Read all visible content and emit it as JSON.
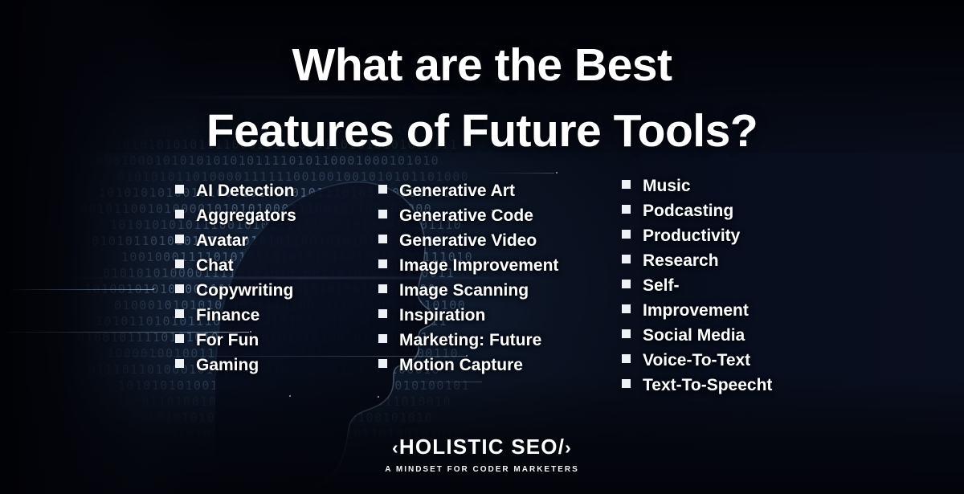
{
  "poster": {
    "title_lines": [
      "What are the Best",
      "Features of Future Tools?"
    ],
    "background": {
      "type": "ai-head-silhouette-binary-code",
      "base_color": "#05060c",
      "navy_color": "#0a0f20",
      "binary_color": "#8fb4d6",
      "binary_rows": [
        "1011010010101010101010010101",
        "0101010101011110001110101011",
        "1000100010101010101011110101",
        "0101010110100001111110010010",
        "1010101010010100010101001011",
        "0010110010100001010101000111",
        "1010101010111001010101101010",
        "0101011010101011010101011001",
        "1001000111101010110101010100",
        "0101010100001111010101010011",
        "1010010101000011110010101010",
        "0100010101010000111101001011",
        "1010110101011101010101010010",
        "0100101111010101000101010101",
        "1000010010011010101011010100",
        "0111011010001010101000101011",
        "1010101010010101010101010010",
        "0010101101001010100010101101",
        "1101010010101010101001010100"
      ]
    },
    "columns": [
      {
        "id": "column-1",
        "items": [
          "AI Detection",
          "Aggregators",
          "Avatar",
          "Chat",
          "Copywriting",
          "Finance",
          "For Fun",
          "Gaming"
        ]
      },
      {
        "id": "column-2",
        "items": [
          "Generative Art",
          "Generative Code",
          "Generative Video",
          "Image Improvement",
          "Image Scanning",
          "Inspiration",
          "Marketing: Future",
          "Motion Capture"
        ]
      },
      {
        "id": "column-3",
        "items": [
          "Music",
          "Podcasting",
          "Productivity",
          "Research",
          "Self-",
          "Improvement",
          "Social Media",
          "Voice-To-Text",
          "Text-To-Speecht"
        ]
      }
    ],
    "logo": {
      "open_bracket": "‹",
      "name": "HOLISTIC SEO",
      "slash": "/",
      "close_bracket": "›",
      "full_mark": "‹HOLISTIC SEO/›",
      "tagline": "A MINDSET FOR CODER MARKETERS",
      "color": "#ffffff"
    }
  }
}
